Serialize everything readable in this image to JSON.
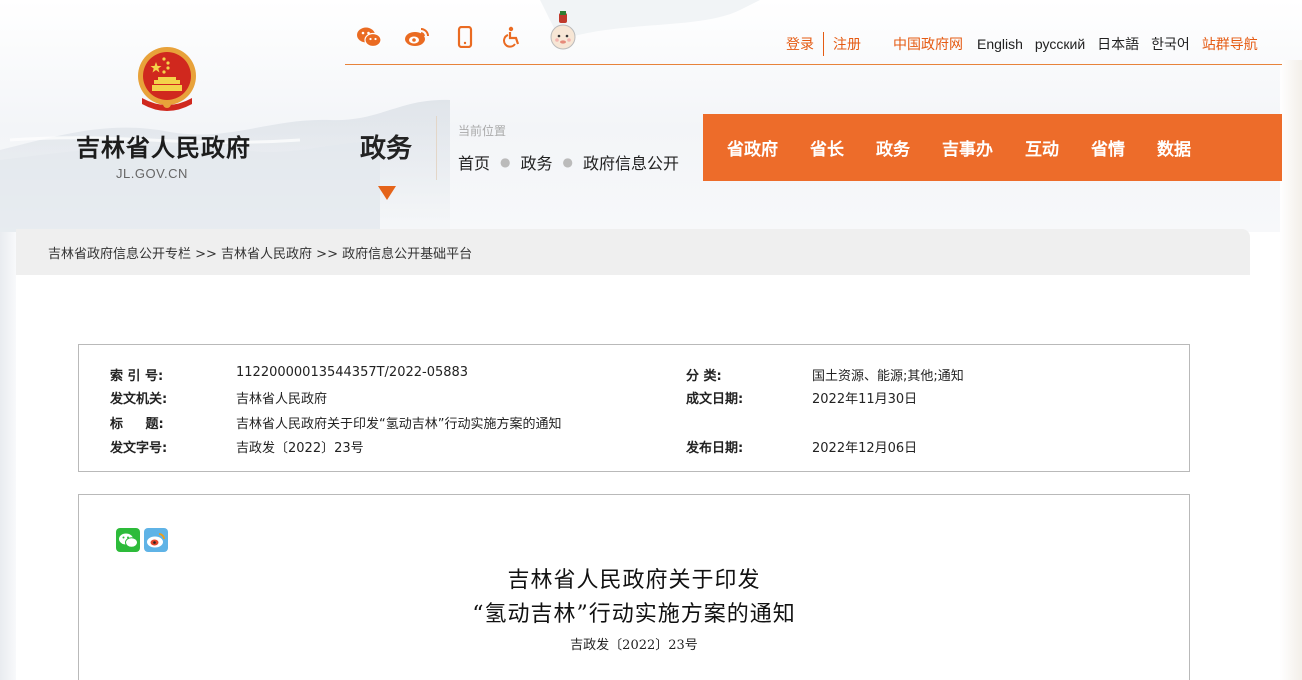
{
  "header": {
    "site_name": "吉林省人民政府",
    "site_domain": "JL.GOV.CN",
    "utility_icons": [
      "wechat-icon",
      "weibo-icon",
      "mobile-icon",
      "accessibility-icon",
      "mascot-icon"
    ],
    "login": "登录",
    "register": "注册",
    "links": {
      "gov_cn": "中国政府网",
      "english": "English",
      "russian": "русский",
      "japanese": "日本語",
      "korean": "한국어",
      "site_nav": "站群导航"
    },
    "section": "政务",
    "location_caption": "当前位置",
    "location": [
      "首页",
      "政务",
      "政府信息公开"
    ]
  },
  "nav": {
    "items": [
      "省政府",
      "省长",
      "政务",
      "吉事办",
      "互动",
      "省情",
      "数据"
    ]
  },
  "breadcrumb": "吉林省政府信息公开专栏 >> 吉林省人民政府 >> 政府信息公开基础平台",
  "meta": {
    "index_label": "索 引 号:",
    "index_value": "11220000013544357T/2022-05883",
    "category_label": "分 类:",
    "category_value": "国土资源、能源;其他;通知",
    "issuer_label": "发文机关:",
    "issuer_value": "吉林省人民政府",
    "written_label": "成文日期:",
    "written_value": "2022年11月30日",
    "title_label": "标 题:",
    "title_value": "吉林省人民政府关于印发“氢动吉林”行动实施方案的通知",
    "docno_label": "发文字号:",
    "docno_value": "吉政发〔2022〕23号",
    "publish_label": "发布日期:",
    "publish_value": "2022年12月06日"
  },
  "document": {
    "title_line1": "吉林省人民政府关于印发",
    "title_line2": "“氢动吉林”行动实施方案的通知",
    "doc_number": "吉政发〔2022〕23号"
  },
  "colors": {
    "accent": "#ed6c2a",
    "link_orange": "#e55b13"
  }
}
